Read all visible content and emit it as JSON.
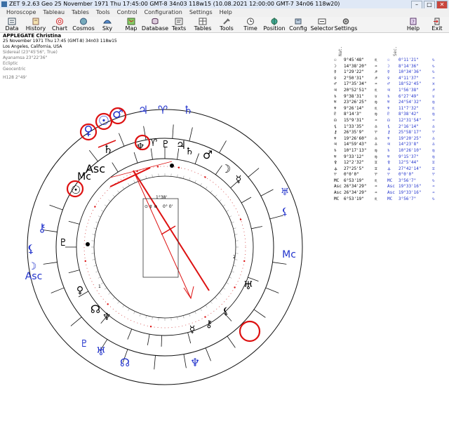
{
  "window": {
    "title": "ZET 9.2.63 Geo    25 November 1971  Thu  17:45:00 GMT-8 34n03  118w15   (10.08.2021  12:00:00 GMT-7 34n06 118w20)"
  },
  "menu": [
    "Horoscope",
    "Tableau",
    "Tables",
    "Tools",
    "Control",
    "Configuration",
    "Settings",
    "Help"
  ],
  "toolbar": [
    {
      "label": "Data",
      "icon": "data-icon"
    },
    {
      "label": "History",
      "icon": "history-icon"
    },
    {
      "label": "Chart",
      "icon": "chart-icon"
    },
    {
      "label": "Cosmos",
      "icon": "cosmos-icon"
    },
    {
      "label": "Sky",
      "icon": "sky-icon"
    },
    {
      "label": "Map",
      "icon": "map-icon"
    },
    {
      "label": "Database",
      "icon": "database-icon"
    },
    {
      "label": "Texts",
      "icon": "texts-icon"
    },
    {
      "label": "Tables",
      "icon": "tables-icon"
    },
    {
      "label": "Tools",
      "icon": "tools-icon"
    },
    {
      "label": "Time",
      "icon": "time-icon"
    },
    {
      "label": "Position",
      "icon": "position-icon"
    },
    {
      "label": "Config",
      "icon": "config-icon"
    },
    {
      "label": "Selector",
      "icon": "selector-icon"
    },
    {
      "label": "Settings",
      "icon": "settings-icon"
    },
    {
      "label": "Help",
      "icon": "help-icon"
    },
    {
      "label": "Exit",
      "icon": "exit-icon"
    }
  ],
  "header": {
    "name": "APPLEGATE Christina",
    "date_line": "25 November 1971  Thu  17:45 (GMT-8) 34n03  118w15",
    "place": "Los Angeles, California, USA",
    "sidereal": "Sidereal (23°45'56\", True)",
    "ayanamsa": "Ayanamsa 23°22'36\"",
    "ecliptic": "Ecliptic",
    "geocentric": "Geocentric",
    "harmonic": "H128  2°49'"
  },
  "positions": {
    "nat_label": "Nat.",
    "sec_label": "Sec.",
    "rows": [
      {
        "p": "☉",
        "n": "9°45'48\"",
        "ns": "♏",
        "sp": "☉",
        "s": "0°11'21\"",
        "ss": "♑"
      },
      {
        "p": "☽",
        "n": "14°38'20\"",
        "ns": "♒",
        "sp": "☽",
        "s": "8°14'36\"",
        "ss": "♑"
      },
      {
        "p": "☿",
        "n": "1°29'22\"",
        "ns": "♐",
        "sp": "☿",
        "s": "10°34'36\"",
        "ss": "♑"
      },
      {
        "p": "♀",
        "n": "2°50'31\"",
        "ns": "♐",
        "sp": "♀",
        "s": "4°11'37\"",
        "ss": "♒"
      },
      {
        "p": "♂",
        "n": "17°35'34\"",
        "ns": "♒",
        "sp": "♂",
        "s": "18°52'45\"",
        "ss": "♓"
      },
      {
        "p": "♃",
        "n": "20°52'51\"",
        "ns": "♏",
        "sp": "♃",
        "s": "1°56'38\"",
        "ss": "♐"
      },
      {
        "p": "♄",
        "n": "9°38'31\"",
        "ns": "♉",
        "sp": "♄",
        "s": "6°27'49\"",
        "ss": "♉"
      },
      {
        "p": "♅",
        "n": "23°26'25\"",
        "ns": "♍",
        "sp": "♅",
        "s": "24°54'32\"",
        "ss": "♍"
      },
      {
        "p": "♆",
        "n": "9°26'14\"",
        "ns": "♏",
        "sp": "♆",
        "s": "11°7'32\"",
        "ss": "♏"
      },
      {
        "p": "♇",
        "n": "8°14'3\"",
        "ns": "♍",
        "sp": "♇",
        "s": "8°38'42\"",
        "ss": "♍"
      },
      {
        "p": "☊",
        "n": "15°9'31\"",
        "ns": "♒",
        "sp": "☊",
        "s": "12°31'54\"",
        "ss": "♒"
      },
      {
        "p": "⚸",
        "n": "1°33'35\"",
        "ns": "♎",
        "sp": "⚸",
        "s": "2°16'14\"",
        "ss": "♎"
      },
      {
        "p": "⚷",
        "n": "26°35'9\"",
        "ns": "♈",
        "sp": "⚷",
        "s": "25°58'17\"",
        "ss": "♈"
      },
      {
        "p": "♆",
        "n": "19°26'60\"",
        "ns": "♎",
        "sp": "♆",
        "s": "19°20'25\"",
        "ss": "♎"
      },
      {
        "p": "♃",
        "n": "14°59'43\"",
        "ns": "♎",
        "sp": "♃",
        "s": "14°23'8\"",
        "ss": "♎"
      },
      {
        "p": "♄",
        "n": "10°17'13\"",
        "ns": "♍",
        "sp": "♄",
        "s": "10°26'10\"",
        "ss": "♍"
      },
      {
        "p": "♅",
        "n": "9°33'12\"",
        "ns": "♍",
        "sp": "♅",
        "s": "9°15'37\"",
        "ss": "♍"
      },
      {
        "p": "⚴",
        "n": "12°2'32\"",
        "ns": "♊",
        "sp": "⚴",
        "s": "12°5'44\"",
        "ss": "♊"
      },
      {
        "p": "⚶",
        "n": "27°25'5\"",
        "ns": "♊",
        "sp": "⚶",
        "s": "27°42'14\"",
        "ss": "♊"
      },
      {
        "p": "♈",
        "n": "0°0'0\"",
        "ns": "♈",
        "sp": "♈",
        "s": "0°0'0\"",
        "ss": "♈"
      },
      {
        "p": "MC",
        "n": "6°53'19\"",
        "ns": "♏",
        "sp": "MC",
        "s": "3°56'7\"",
        "ss": "♑"
      },
      {
        "p": "Asc",
        "n": "26°34'29\"",
        "ns": "♒",
        "sp": "Asc",
        "s": "19°33'16\"",
        "ss": "♒"
      },
      {
        "p": "Asc",
        "n": "26°34'29\"",
        "ns": "♒",
        "sp": "Asc",
        "s": "19°33'16\"",
        "ss": "♒"
      },
      {
        "p": "MC",
        "n": "6°53'19\"",
        "ns": "♏",
        "sp": "MC",
        "s": "3°56'7\"",
        "ss": "♑"
      }
    ]
  },
  "wheel": {
    "outer_labels": [
      {
        "name": "venus-sec-glyph",
        "t": "♀",
        "color": "#2233cc"
      },
      {
        "name": "sun-sec-glyph",
        "t": "☉",
        "color": "#2233cc"
      },
      {
        "name": "mars-sec-glyph",
        "t": "♂",
        "color": "#2233cc"
      },
      {
        "name": "jupiter-sec-glyph",
        "t": "♃",
        "color": "#2233cc"
      },
      {
        "name": "aries-sec-glyph",
        "t": "♈",
        "color": "#2233cc"
      },
      {
        "name": "saturn-sec-glyph",
        "t": "♄",
        "color": "#2233cc"
      },
      {
        "name": "chiron-sec-glyph",
        "t": "⚷",
        "color": "#2233cc"
      },
      {
        "name": "lilith-sec-glyph",
        "t": "⚸",
        "color": "#2233cc"
      },
      {
        "name": "moon-sec-glyph",
        "t": "☽",
        "color": "#2233cc"
      },
      {
        "name": "asc-sec-glyph",
        "t": "Asc",
        "color": "#2233cc"
      },
      {
        "name": "uranus-sec-glyph",
        "t": "♅",
        "color": "#2233cc"
      },
      {
        "name": "mc-sec-glyph",
        "t": "Mc",
        "color": "#2233cc"
      },
      {
        "name": "pluto-sec-glyph",
        "t": "♇",
        "color": "#2233cc"
      },
      {
        "name": "uranus-sec2-glyph",
        "t": "♅",
        "color": "#2233cc"
      },
      {
        "name": "node-sec-glyph",
        "t": "☊",
        "color": "#2233cc"
      },
      {
        "name": "lilith-sec2-glyph",
        "t": "⚸",
        "color": "#2233cc"
      },
      {
        "name": "neptune-sec-glyph",
        "t": "♆",
        "color": "#2233cc"
      }
    ],
    "inner_labels": [
      {
        "name": "saturn-nat-glyph",
        "t": "♄"
      },
      {
        "name": "neptune-nat-glyph",
        "t": "♆"
      },
      {
        "name": "aries-nat-glyph",
        "t": "♈"
      },
      {
        "name": "pluto-nat-glyph",
        "t": "♇"
      },
      {
        "name": "jupiter-nat-glyph",
        "t": "♃"
      },
      {
        "name": "mars-nat-glyph",
        "t": "♂"
      },
      {
        "name": "moon-nat-glyph",
        "t": "☽"
      },
      {
        "name": "mercury-nat-glyph",
        "t": "☿"
      },
      {
        "name": "asc-nat-glyph",
        "t": "Asc"
      },
      {
        "name": "mc-nat-glyph",
        "t": "Mc"
      },
      {
        "name": "sun-nat-glyph",
        "t": "☉"
      },
      {
        "name": "venus-nat-glyph",
        "t": "♀"
      },
      {
        "name": "uranus-nat-glyph",
        "t": "♅"
      },
      {
        "name": "node-nat-glyph",
        "t": "☊"
      },
      {
        "name": "neptune-nat2-glyph",
        "t": "♆"
      },
      {
        "name": "lilith-nat-glyph",
        "t": "⚸"
      },
      {
        "name": "chiron-nat-glyph",
        "t": "⚷"
      },
      {
        "name": "mercury-nat2-glyph",
        "t": "☿"
      },
      {
        "name": "pluto-nat2-glyph",
        "t": "♇"
      },
      {
        "name": "saturn-nat2-glyph",
        "t": "♄"
      }
    ],
    "box_angle": "1°38'",
    "box_text": "0° 0'",
    "ticks": [
      "1",
      "2"
    ]
  },
  "colors": {
    "red": "#dd1111",
    "blue": "#2233cc",
    "black": "#000000"
  }
}
